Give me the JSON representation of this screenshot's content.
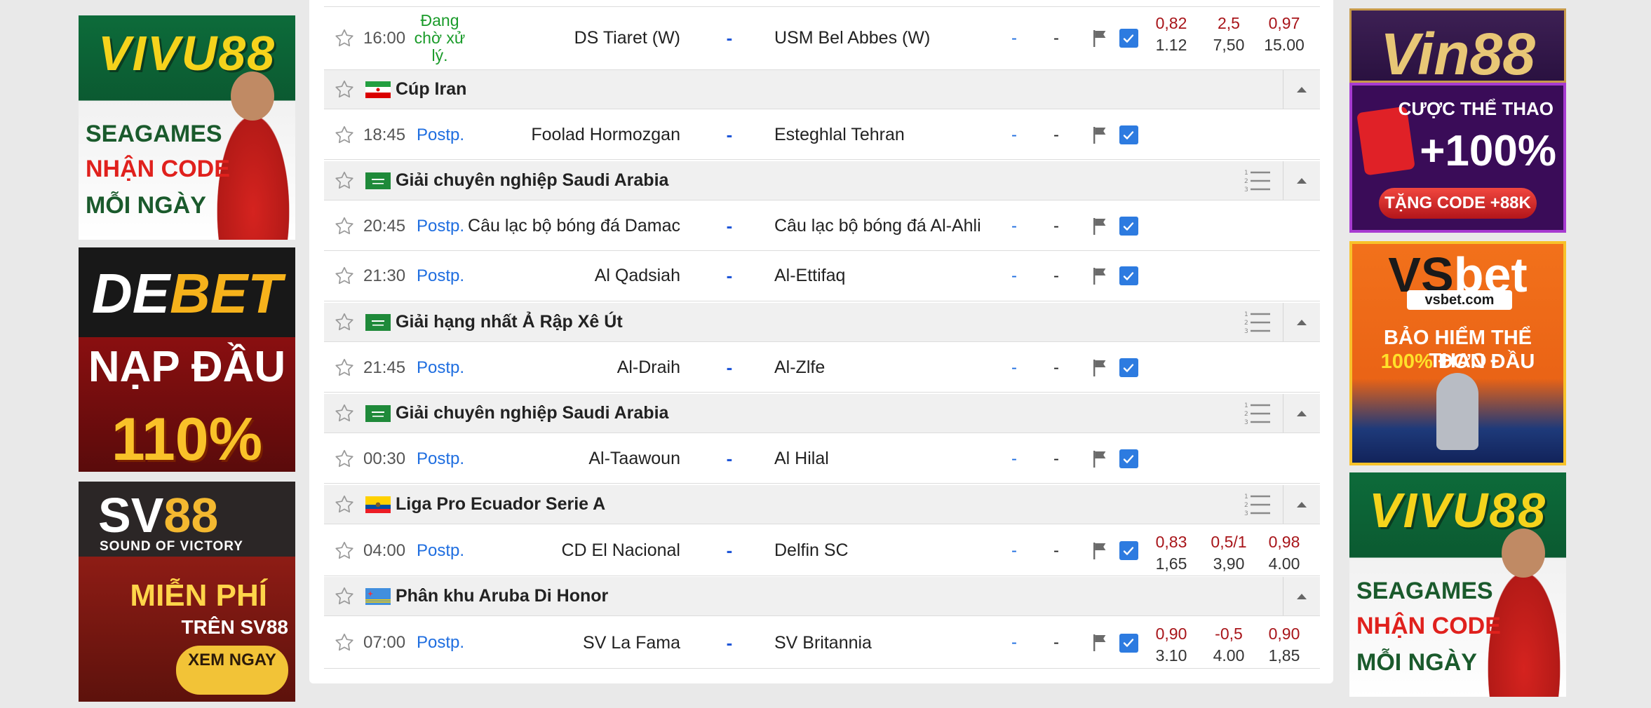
{
  "ads": {
    "left": [
      {
        "brand_a": "VIVU88",
        "line1": "SEAGAMES",
        "line2": "NHẬN CODE",
        "line3": "MỖI NGÀY"
      },
      {
        "brand_a": "DE",
        "brand_b": "BET",
        "line1": "NẠP ĐẦU",
        "line2": "110%"
      },
      {
        "brand_a": "SV",
        "brand_b": "88",
        "tagline": "SOUND OF VICTORY",
        "line1": "MIỄN PHÍ",
        "line2": "TRÊN SV88",
        "cta": "XEM NGAY"
      }
    ],
    "right": [
      {
        "brand_a": "Vin88"
      },
      {
        "line1": "CƯỢC THỂ THAO",
        "line2": "+100%",
        "line3": "TẶNG CODE +88K"
      },
      {
        "brand_a": "VS",
        "brand_b": "bet",
        "domain": "vsbet.com",
        "line1": "BẢO HIỂM THỂ THAO",
        "line2a": "100%",
        "line2b": " ĐƠN ĐẦU"
      },
      {
        "brand_a": "VIVU88",
        "line1": "SEAGAMES",
        "line2": "NHẬN CODE",
        "line3": "MỖI NGÀY"
      }
    ]
  },
  "rows": [
    {
      "kind": "match",
      "time": "16:00",
      "status": "Đang chờ xử lý.",
      "status_live": true,
      "home": "DS Tiaret (W)",
      "dash": "-",
      "away": "USM Bel Abbes (W)",
      "score_half": "-",
      "score_ht": "-",
      "odds": [
        [
          "0,82",
          "1.12"
        ],
        [
          "2,5",
          "7,50"
        ],
        [
          "0,97",
          "15.00"
        ]
      ]
    },
    {
      "kind": "league",
      "name": "Cúp Iran",
      "flag": "iran",
      "rank": false
    },
    {
      "kind": "match",
      "time": "18:45",
      "status": "Postp.",
      "home": "Foolad Hormozgan",
      "dash": "-",
      "away": "Esteghlal Tehran",
      "score_half": "-",
      "score_ht": "-",
      "odds": null
    },
    {
      "kind": "league",
      "name": "Giải chuyên nghiệp Saudi Arabia",
      "flag": "saudi",
      "rank": true
    },
    {
      "kind": "match",
      "time": "20:45",
      "status": "Postp.",
      "home": "Câu lạc bộ bóng đá Damac",
      "dash": "-",
      "away": "Câu lạc bộ bóng đá Al-Ahli",
      "score_half": "-",
      "score_ht": "-",
      "odds": null
    },
    {
      "kind": "match",
      "time": "21:30",
      "status": "Postp.",
      "home": "Al Qadsiah",
      "dash": "-",
      "away": "Al-Ettifaq",
      "score_half": "-",
      "score_ht": "-",
      "odds": null
    },
    {
      "kind": "league",
      "name": "Giải hạng nhất Ả Rập Xê Út",
      "flag": "saudi",
      "rank": true
    },
    {
      "kind": "match",
      "time": "21:45",
      "status": "Postp.",
      "home": "Al-Draih",
      "dash": "-",
      "away": "Al-Zlfe",
      "score_half": "-",
      "score_ht": "-",
      "odds": null
    },
    {
      "kind": "league",
      "name": "Giải chuyên nghiệp Saudi Arabia",
      "flag": "saudi",
      "rank": true
    },
    {
      "kind": "match",
      "time": "00:30",
      "status": "Postp.",
      "home": "Al-Taawoun",
      "dash": "-",
      "away": "Al Hilal",
      "score_half": "-",
      "score_ht": "-",
      "odds": null
    },
    {
      "kind": "league",
      "name": "Liga Pro Ecuador Serie A",
      "flag": "ecuador",
      "rank": true
    },
    {
      "kind": "match",
      "time": "04:00",
      "status": "Postp.",
      "home": "CD El Nacional",
      "dash": "-",
      "away": "Delfin SC",
      "score_half": "-",
      "score_ht": "-",
      "odds": [
        [
          "0,83",
          "1,65"
        ],
        [
          "0,5/1",
          "3,90"
        ],
        [
          "0,98",
          "4.00"
        ]
      ]
    },
    {
      "kind": "league",
      "name": "Phân khu Aruba Di Honor",
      "flag": "aruba",
      "rank": false
    },
    {
      "kind": "match",
      "time": "07:00",
      "status": "Postp.",
      "home": "SV La Fama",
      "dash": "-",
      "away": "SV Britannia",
      "score_half": "-",
      "score_ht": "-",
      "odds": [
        [
          "0,90",
          "3.10"
        ],
        [
          "-0,5",
          "4.00"
        ],
        [
          "0,90",
          "1,85"
        ]
      ]
    }
  ],
  "icons": {
    "star": "star-outline-icon",
    "flag": "report-flag-icon",
    "check": "checkbox-checked-icon",
    "rank": "standings-list-icon",
    "collapse": "collapse-arrow-icon"
  },
  "colors": {
    "status_postp": "#1f6ee0",
    "status_live": "#1a9b2a",
    "odds_up": "#a8151a",
    "checkbox": "#2d7be0"
  }
}
